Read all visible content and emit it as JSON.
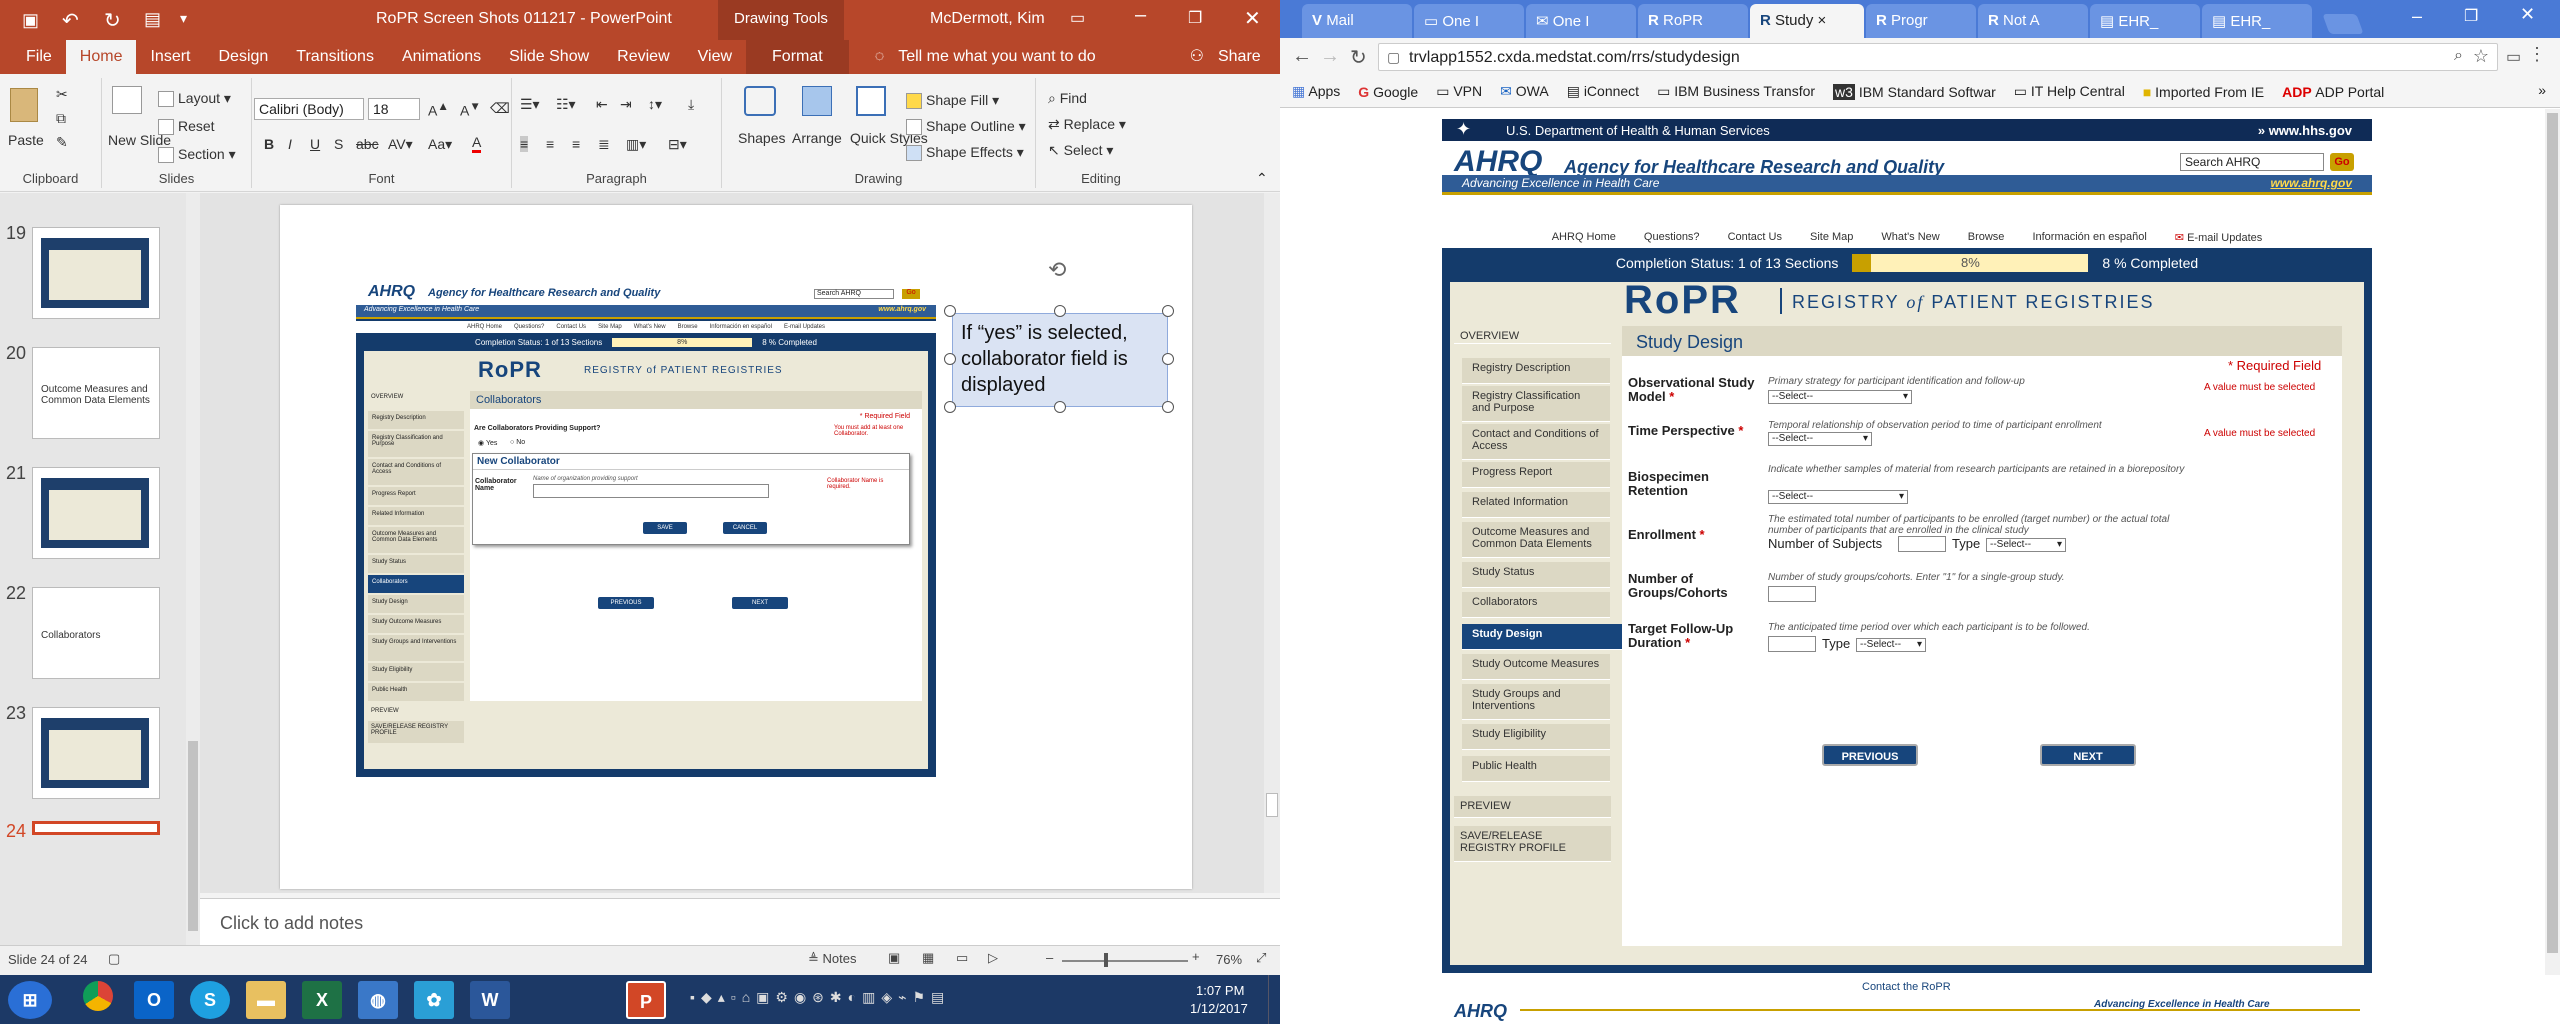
{
  "ppt": {
    "title": "RoPR Screen Shots 011217 - PowerPoint",
    "drawing_tools": "Drawing Tools",
    "user": "McDermott, Kim",
    "tabs": [
      "File",
      "Home",
      "Insert",
      "Design",
      "Transitions",
      "Animations",
      "Slide Show",
      "Review",
      "View",
      "Format"
    ],
    "tell_me": "Tell me what you want to do",
    "share": "Share",
    "ribbon": {
      "paste": "Paste",
      "clipboard": "Clipboard",
      "new_slide": "New Slide",
      "layout": "Layout",
      "reset": "Reset",
      "section": "Section",
      "slides": "Slides",
      "font_name": "Calibri (Body)",
      "font_size": "18",
      "font": "Font",
      "paragraph": "Paragraph",
      "shapes": "Shapes",
      "arrange": "Arrange",
      "quick_styles": "Quick Styles",
      "shape_fill": "Shape Fill",
      "shape_outline": "Shape Outline",
      "shape_effects": "Shape Effects",
      "drawing": "Drawing",
      "find": "Find",
      "replace": "Replace",
      "select": "Select",
      "editing": "Editing"
    },
    "thumbnails": [
      {
        "num": "19",
        "text": ""
      },
      {
        "num": "20",
        "text": "Outcome Measures and Common Data Elements"
      },
      {
        "num": "21",
        "text": ""
      },
      {
        "num": "22",
        "text": "Collaborators"
      },
      {
        "num": "23",
        "text": ""
      },
      {
        "num": "24",
        "text": ""
      }
    ],
    "slide": {
      "callout": "If “yes” is selected, collaborator field is displayed",
      "agency": "Agency for Healthcare Research and Quality",
      "tagline": "Advancing Excellence in Health Care",
      "url": "www.ahrq.gov",
      "search": "Search AHRQ",
      "go": "Go",
      "nav": [
        "AHRQ Home",
        "Questions?",
        "Contact Us",
        "Site Map",
        "What's New",
        "Browse",
        "Información en español",
        "E-mail Updates"
      ],
      "completion": "Completion Status: 1 of 13 Sections",
      "pct": "8%",
      "pct_completed": "8 % Completed",
      "ropr": "RoPR",
      "registry": "REGISTRY of PATIENT REGISTRIES",
      "section_title": "Collaborators",
      "required": "* Required Field",
      "question": "Are Collaborators Providing Support?",
      "yes": "Yes",
      "no": "No",
      "must_add": "You must add at least one Collaborator.",
      "new_collab": "New Collaborator",
      "collab_name": "Collaborator Name",
      "collab_hint": "Name of organization providing support",
      "collab_err": "Collaborator Name is required.",
      "save": "SAVE",
      "cancel": "CANCEL",
      "previous": "PREVIOUS",
      "next": "NEXT",
      "side": [
        "OVERVIEW",
        "Registry Description",
        "Registry Classification and Purpose",
        "Contact and Conditions of Access",
        "Progress Report",
        "Related Information",
        "Outcome Measures and Common Data Elements",
        "Study Status",
        "Collaborators",
        "Study Design",
        "Study Outcome Measures",
        "Study Groups and Interventions",
        "Study Eligibility",
        "Public Health",
        "PREVIEW",
        "SAVE/RELEASE REGISTRY PROFILE"
      ]
    },
    "notes": "Click to add notes",
    "status_slide": "Slide 24 of 24",
    "status_notes": "Notes",
    "zoom": "76%"
  },
  "chrome": {
    "tabs": [
      "Mail",
      "One I",
      "One I",
      "RoPR",
      "Study",
      "Progr",
      "Not A",
      "EHR_",
      "EHR_"
    ],
    "url": "trvlapp1552.cxda.medstat.com/rrs/studydesign",
    "bookmarks": [
      "Apps",
      "Google",
      "VPN",
      "OWA",
      "iConnect",
      "IBM Business Transfor",
      "IBM Standard Softwar",
      "IT Help Central",
      "Imported From IE",
      "ADP Portal"
    ]
  },
  "page": {
    "hhs": "U.S. Department of Health & Human Services",
    "hhs_url": "www.hhs.gov",
    "ahrq": "AHRQ",
    "agency": "Agency for Healthcare Research and Quality",
    "tagline": "Advancing Excellence in Health Care",
    "url": "www.ahrq.gov",
    "search": "Search AHRQ",
    "go": "Go",
    "nav": [
      "AHRQ Home",
      "Questions?",
      "Contact Us",
      "Site Map",
      "What's New",
      "Browse",
      "Información en español",
      "E-mail Updates"
    ],
    "completion": "Completion Status: 1 of 13 Sections",
    "progress": 0.08,
    "pct": "8%",
    "pct_completed": "8 % Completed",
    "ropr": "RoPR",
    "registry_a": "REGISTRY",
    "registry_of": "of",
    "registry_b": "PATIENT REGISTRIES",
    "sidebar": [
      {
        "label": "OVERVIEW",
        "type": "sec"
      },
      {
        "label": "Registry Description",
        "type": "item"
      },
      {
        "label": "Registry Classification and Purpose",
        "type": "item"
      },
      {
        "label": "Contact and Conditions of Access",
        "type": "item"
      },
      {
        "label": "Progress Report",
        "type": "item"
      },
      {
        "label": "Related Information",
        "type": "item"
      },
      {
        "label": "Outcome Measures and Common Data Elements",
        "type": "item"
      },
      {
        "label": "Study Status",
        "type": "item"
      },
      {
        "label": "Collaborators",
        "type": "item"
      },
      {
        "label": "Study Design",
        "type": "active"
      },
      {
        "label": "Study Outcome Measures",
        "type": "item"
      },
      {
        "label": "Study Groups and Interventions",
        "type": "item"
      },
      {
        "label": "Study Eligibility",
        "type": "item"
      },
      {
        "label": "Public Health",
        "type": "item"
      },
      {
        "label": "PREVIEW",
        "type": "sec"
      },
      {
        "label": "SAVE/RELEASE REGISTRY PROFILE",
        "type": "sec"
      }
    ],
    "title": "Study Design",
    "required": "* Required Field",
    "fields": {
      "obs_label": "Observational Study Model",
      "obs_hint": "Primary strategy for participant identification and follow-up",
      "obs_val": "--Select--",
      "obs_err": "A value must be selected",
      "time_label": "Time Perspective",
      "time_hint": "Temporal relationship of observation period to time of participant enrollment",
      "time_val": "--Select--",
      "time_err": "A value must be selected",
      "bio_label": "Biospecimen Retention",
      "bio_hint": "Indicate whether samples of material from research participants are retained in a biorepository",
      "bio_val": "--Select--",
      "enr_label": "Enrollment",
      "enr_hint": "The estimated total number of participants to be enrolled (target number) or the actual total number of participants that are enrolled in the clinical study",
      "enr_num": "Number of Subjects",
      "enr_type": "Type",
      "enr_val": "--Select--",
      "grp_label": "Number of Groups/Cohorts",
      "grp_hint": "Number of study groups/cohorts. Enter \"1\" for a single-group study.",
      "fu_label": "Target Follow-Up Duration",
      "fu_hint": "The anticipated time period over which each participant is to be followed.",
      "fu_type": "Type",
      "fu_val": "--Select--"
    },
    "previous": "PREVIOUS",
    "next": "NEXT",
    "footer_contact": "Contact the RoPR",
    "footer_tag": "Advancing Excellence in Health Care"
  },
  "taskbar": {
    "time": "1:07 PM",
    "date": "1/12/2017"
  }
}
